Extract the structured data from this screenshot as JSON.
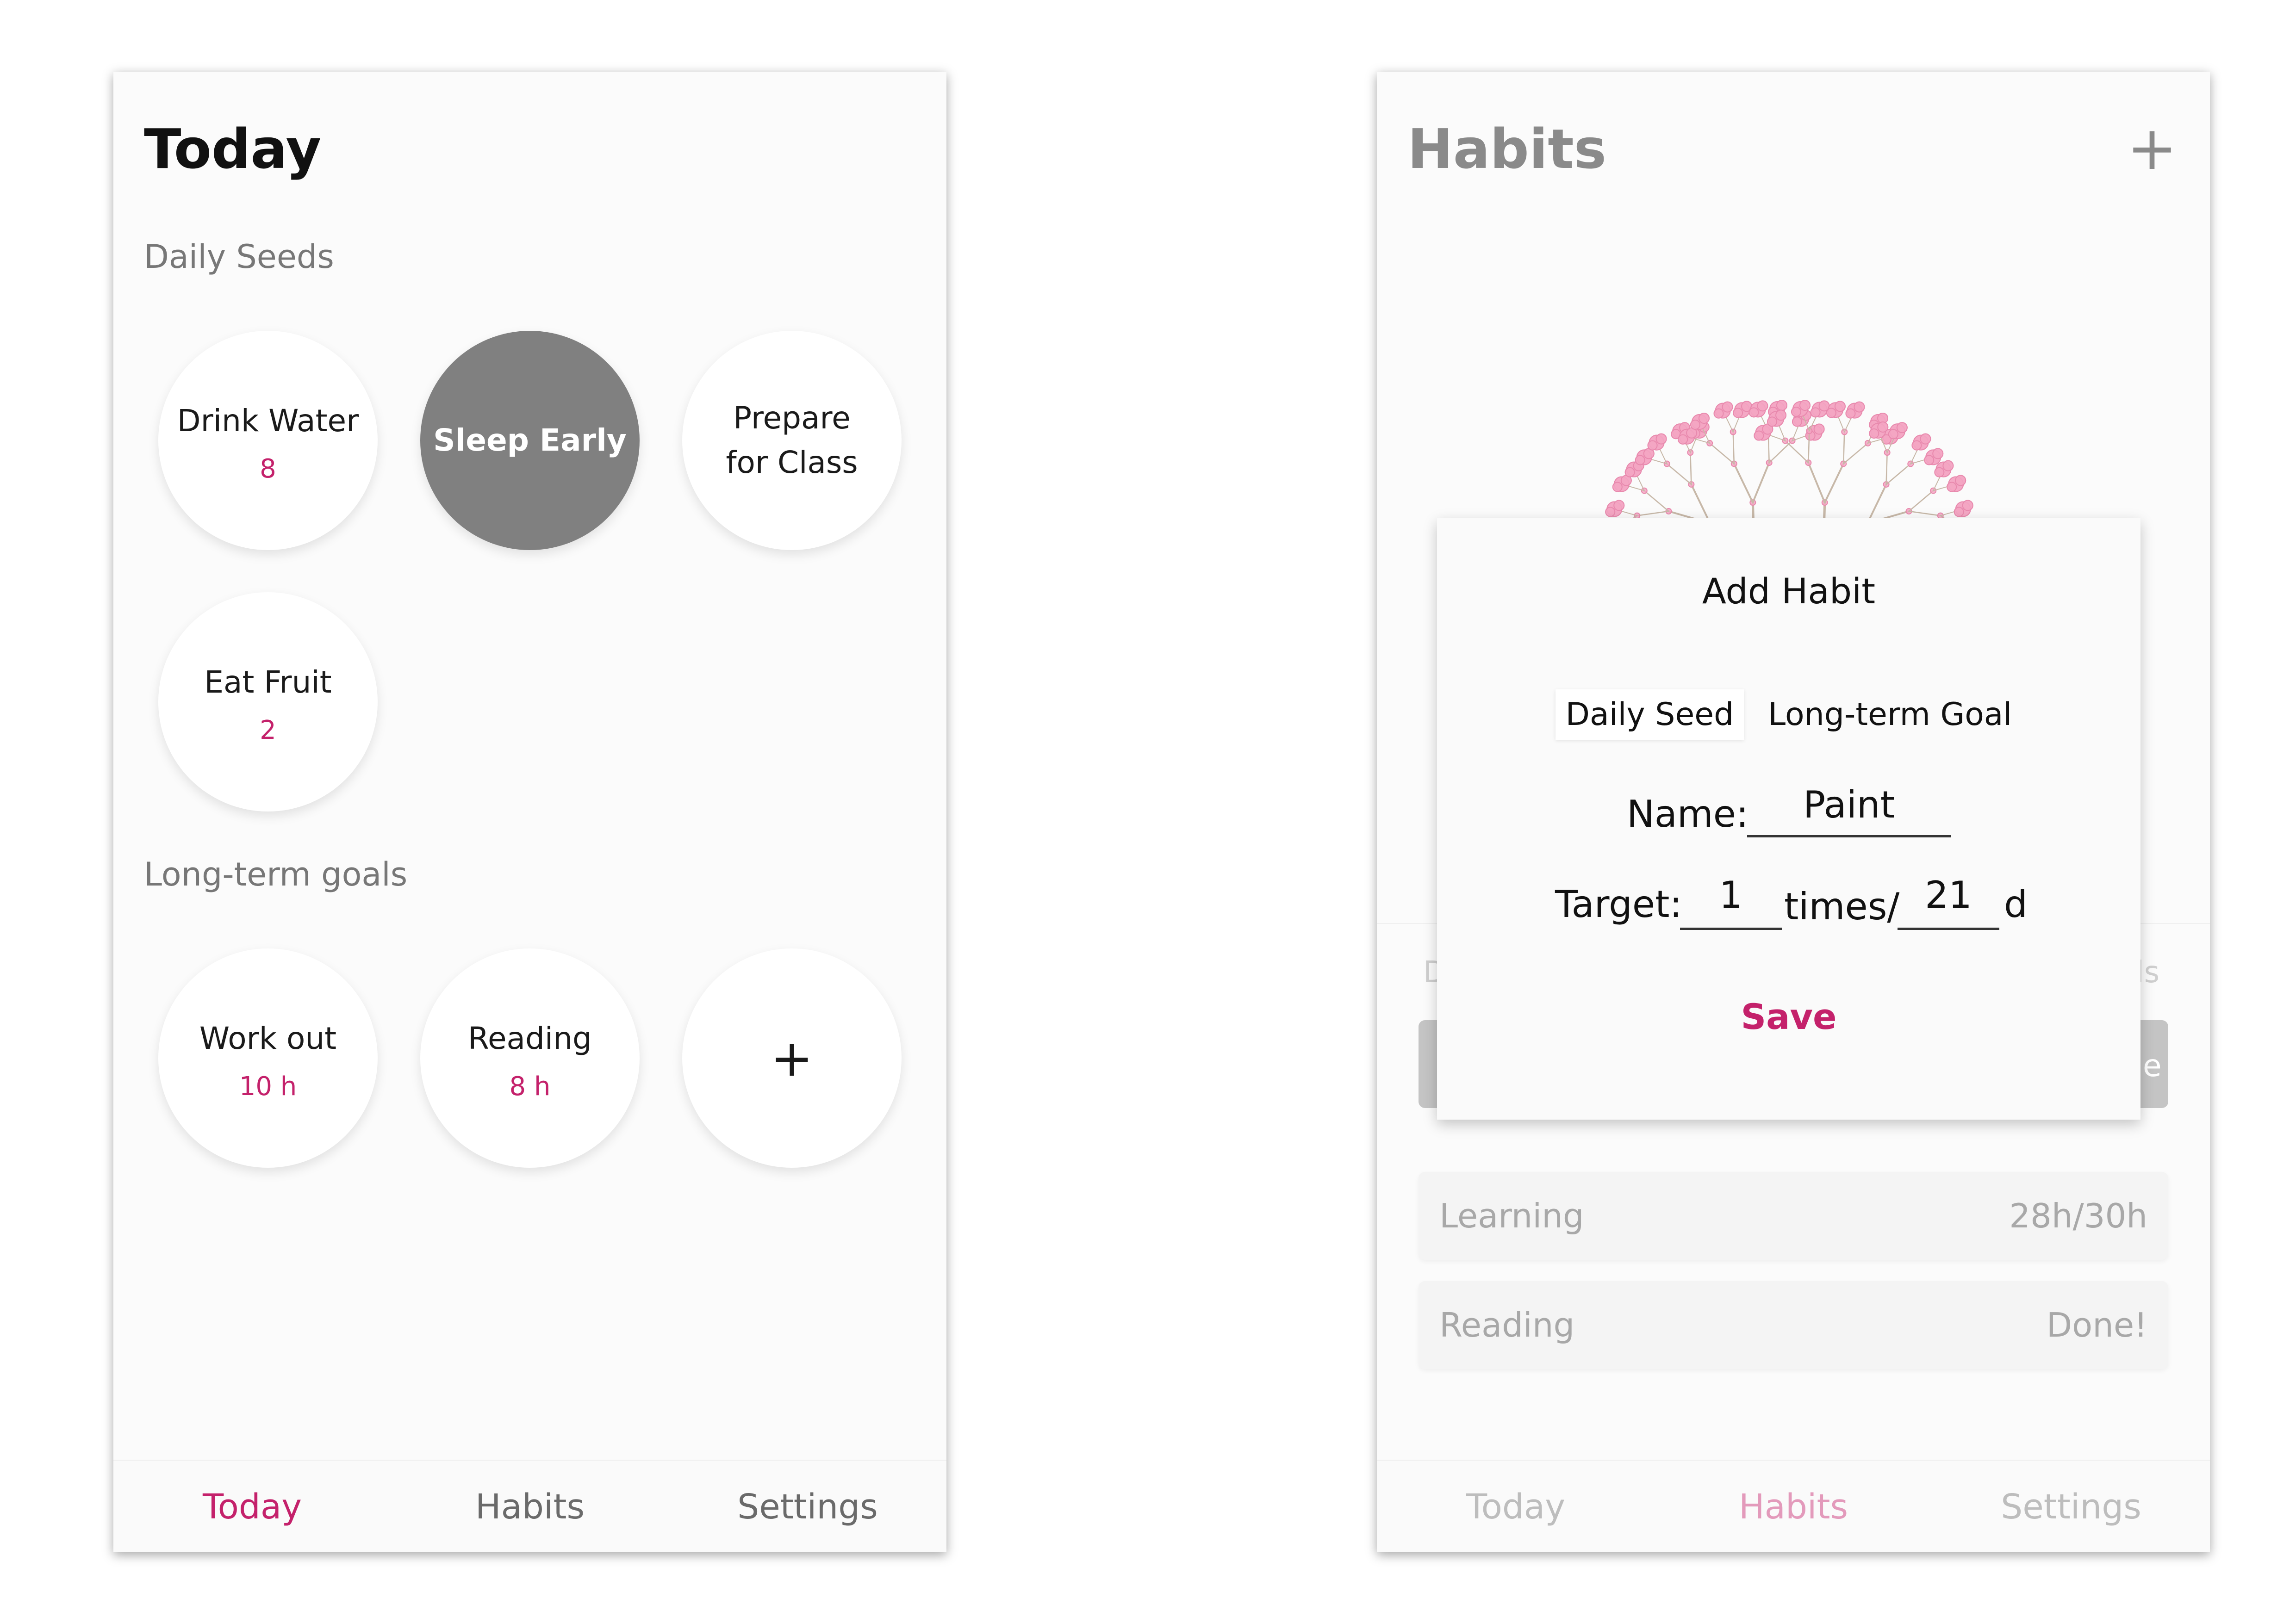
{
  "today_screen": {
    "title": "Today",
    "daily_section": "Daily Seeds",
    "daily_seeds": [
      {
        "name": "Drink Water",
        "count": "8"
      },
      {
        "name": "Sleep Early",
        "count": ""
      },
      {
        "name": "Prepare for Class",
        "count": ""
      },
      {
        "name": "Eat Fruit",
        "count": "2"
      }
    ],
    "goals_section": "Long-term goals",
    "long_term_goals": [
      {
        "name": "Work out",
        "amount": "10 h"
      },
      {
        "name": "Reading",
        "amount": "8 h"
      }
    ],
    "add_label": "+",
    "nav": [
      "Today",
      "Habits",
      "Settings"
    ],
    "active_nav": "Today"
  },
  "habits_screen": {
    "title": "Habits",
    "add_label": "+",
    "background_rows": [
      {
        "label": "Learning",
        "value": "28h/30h"
      },
      {
        "label": "Reading",
        "value": "Done!"
      }
    ],
    "background_fragments": [
      "D",
      "ls",
      "e"
    ],
    "modal": {
      "title": "Add Habit",
      "tabs": [
        "Daily Seed",
        "Long-term Goal"
      ],
      "active_tab": "Daily Seed",
      "name_label": "Name:",
      "name_value": "Paint",
      "target_label": "Target:",
      "target_times": "1",
      "times_label": "times/",
      "target_days": "21",
      "days_unit": "d",
      "save_label": "Save"
    },
    "nav": [
      "Today",
      "Habits",
      "Settings"
    ],
    "active_nav": "Habits"
  },
  "colors": {
    "accent": "#c4216b",
    "active_seed": "#808080",
    "blossom": "#f3a6c3",
    "branch": "#c7b8a8"
  },
  "icons": [
    "plus-icon",
    "plus-icon"
  ]
}
